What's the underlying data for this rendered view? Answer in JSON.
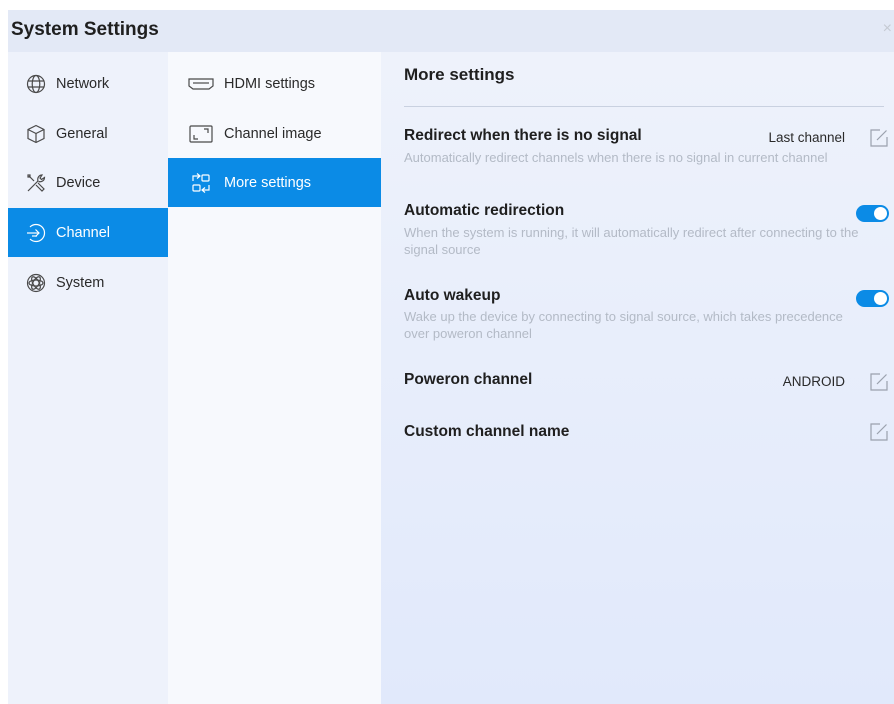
{
  "window": {
    "title": "System Settings",
    "close_glyph": "×"
  },
  "sidebar": {
    "items": [
      {
        "label": "Network",
        "icon": "globe-icon",
        "active": false
      },
      {
        "label": "General",
        "icon": "cube-icon",
        "active": false
      },
      {
        "label": "Device",
        "icon": "tools-icon",
        "active": false
      },
      {
        "label": "Channel",
        "icon": "channel-arrow-icon",
        "active": true
      },
      {
        "label": "System",
        "icon": "atom-icon",
        "active": false
      }
    ]
  },
  "subnav": {
    "items": [
      {
        "label": "HDMI settings",
        "icon": "hdmi-port-icon",
        "active": false
      },
      {
        "label": "Channel image",
        "icon": "frame-corners-icon",
        "active": false
      },
      {
        "label": "More settings",
        "icon": "switch-arrows-icon",
        "active": true
      }
    ]
  },
  "content": {
    "title": "More settings",
    "rows": [
      {
        "title": "Redirect when there is no signal",
        "value": "Last channel",
        "desc": "Automatically redirect channels when there is no signal in current channel",
        "control": "edit"
      },
      {
        "title": "Automatic redirection",
        "desc": "When the system is running, it will automatically redirect after connecting to the signal source",
        "control": "toggle",
        "on": true
      },
      {
        "title": "Auto wakeup",
        "desc": "Wake up the device by connecting to signal source, which takes precedence over poweron channel",
        "control": "toggle",
        "on": true
      },
      {
        "title": "Poweron channel",
        "value": "ANDROID",
        "control": "edit"
      },
      {
        "title": "Custom channel name",
        "control": "edit"
      }
    ]
  },
  "colors": {
    "accent": "#0b8be6",
    "background": "#eef2fb",
    "muted_text": "#b3bac6"
  }
}
